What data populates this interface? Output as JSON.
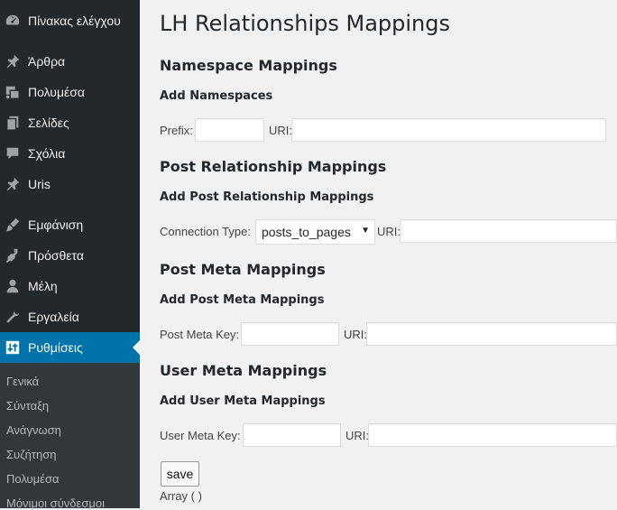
{
  "sidebar": {
    "items": [
      {
        "label": "Πίνακας ελέγχου",
        "icon": "dashboard-icon"
      },
      {
        "label": "Άρθρα",
        "icon": "pin-icon"
      },
      {
        "label": "Πολυμέσα",
        "icon": "media-icon"
      },
      {
        "label": "Σελίδες",
        "icon": "pages-icon"
      },
      {
        "label": "Σχόλια",
        "icon": "comments-icon"
      },
      {
        "label": "Uris",
        "icon": "pin-icon"
      },
      {
        "label": "Εμφάνιση",
        "icon": "appearance-icon"
      },
      {
        "label": "Πρόσθετα",
        "icon": "plugins-icon"
      },
      {
        "label": "Μέλη",
        "icon": "users-icon"
      },
      {
        "label": "Εργαλεία",
        "icon": "tools-icon"
      },
      {
        "label": "Ρυθμίσεις",
        "icon": "settings-icon"
      }
    ],
    "submenu": [
      "Γενικά",
      "Σύνταξη",
      "Ανάγνωση",
      "Συζήτηση",
      "Πολυμέσα",
      "Μόνιμοι σύνδεσμοι"
    ],
    "colors": {
      "bg": "#23282d",
      "active": "#0073aa",
      "submenu_bg": "#32373c"
    }
  },
  "page": {
    "title": "LH Relationships Mappings",
    "namespace": {
      "heading": "Namespace Mappings",
      "subheading": "Add Namespaces",
      "prefix_label": "Prefix:",
      "prefix_value": "",
      "uri_label": "URI:",
      "uri_value": ""
    },
    "post_relationship": {
      "heading": "Post Relationship Mappings",
      "subheading": "Add Post Relationship Mappings",
      "connection_label": "Connection Type:",
      "connection_value": "posts_to_pages",
      "uri_label": "URI:",
      "uri_value": ""
    },
    "post_meta": {
      "heading": "Post Meta Mappings",
      "subheading": "Add Post Meta Mappings",
      "key_label": "Post Meta Key:",
      "key_value": "",
      "uri_label": "URI:",
      "uri_value": ""
    },
    "user_meta": {
      "heading": "User Meta Mappings",
      "subheading": "Add User Meta Mappings",
      "key_label": "User Meta Key:",
      "key_value": "",
      "uri_label": "URI:",
      "uri_value": ""
    },
    "save_label": "save",
    "output_text": "Array ( )"
  }
}
